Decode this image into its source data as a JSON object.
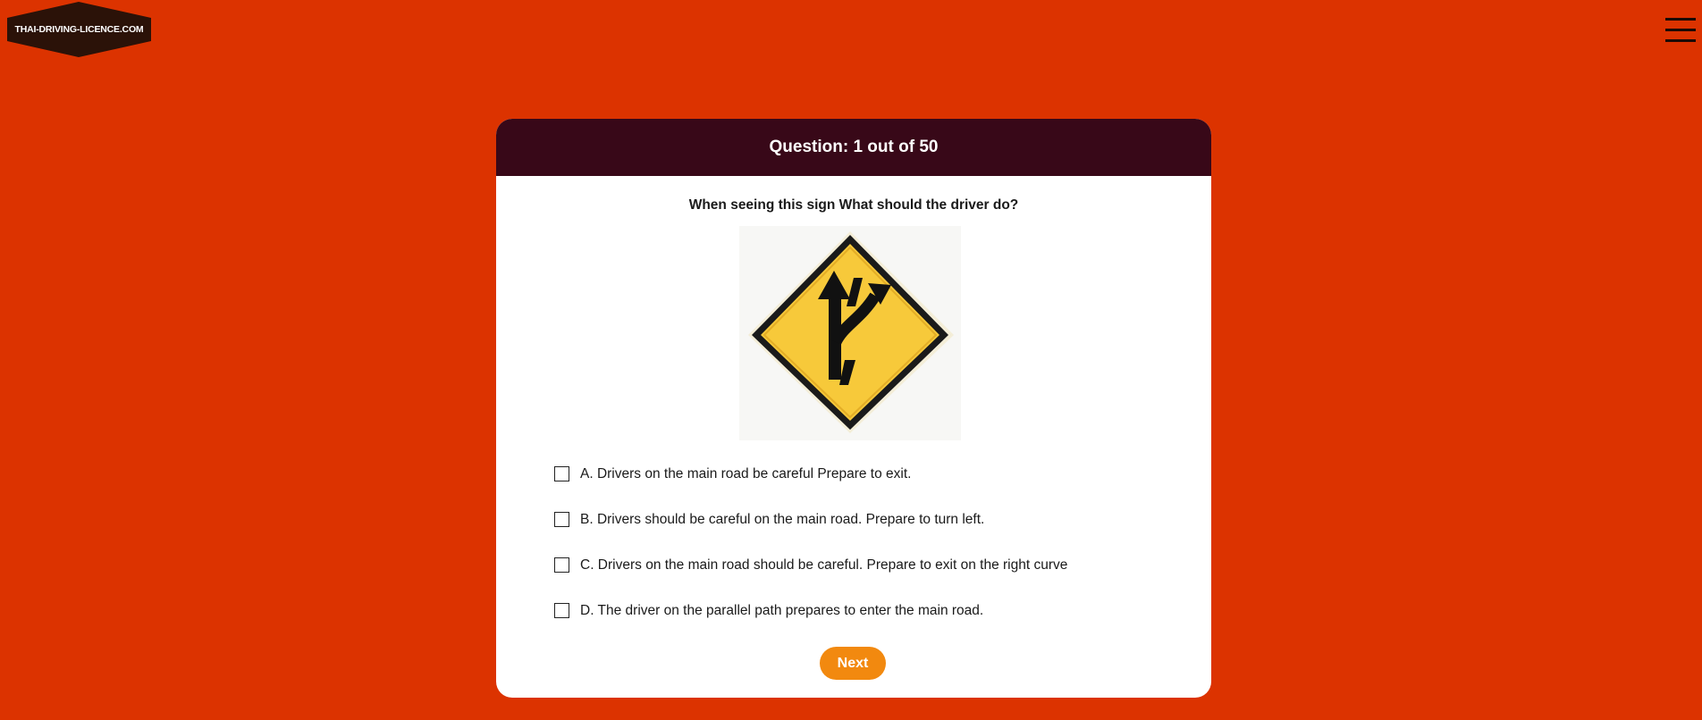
{
  "site": {
    "logo_text": "THAI-DRIVING-LICENCE.COM"
  },
  "menu": {
    "icon": "hamburger-menu-icon"
  },
  "quiz": {
    "header": "Question: 1 out of 50",
    "question": "When seeing this sign What should the driver do?",
    "sign_image": "merging-lanes-warning-sign",
    "options": [
      {
        "label": "A. Drivers on the main road be careful Prepare to exit."
      },
      {
        "label": "B. Drivers should be careful on the main road. Prepare to turn left."
      },
      {
        "label": "C. Drivers on the main road should be careful. Prepare to exit on the right curve"
      },
      {
        "label": "D. The driver on the parallel path prepares to enter the main road."
      }
    ],
    "next_label": "Next"
  },
  "colors": {
    "page_background": "#DC3300",
    "header_background": "#380818",
    "next_button": "#F2890F",
    "sign_yellow": "#F7C93A"
  }
}
